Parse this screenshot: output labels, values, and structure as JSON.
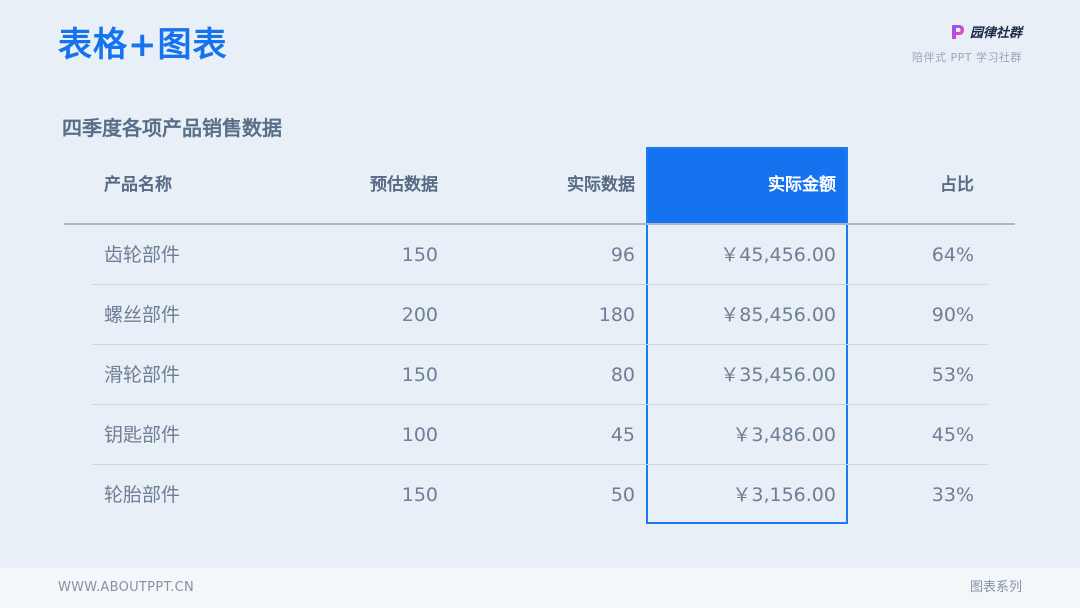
{
  "header": {
    "title": "表格+图表",
    "brand_name": "园律社群",
    "brand_tagline": "陪伴式 PPT 学习社群"
  },
  "subtitle": "四季度各项产品销售数据",
  "table": {
    "columns": [
      "产品名称",
      "预估数据",
      "实际数据",
      "实际金额",
      "占比"
    ],
    "highlight_column_index": 3,
    "rows": [
      [
        "齿轮部件",
        "150",
        "96",
        "￥45,456.00",
        "64%"
      ],
      [
        "螺丝部件",
        "200",
        "180",
        "￥85,456.00",
        "90%"
      ],
      [
        "滑轮部件",
        "150",
        "80",
        "￥35,456.00",
        "53%"
      ],
      [
        "钥匙部件",
        "100",
        "45",
        "￥3,486.00",
        "45%"
      ],
      [
        "轮胎部件",
        "150",
        "50",
        "￥3,156.00",
        "33%"
      ]
    ]
  },
  "footer": {
    "website": "WWW.ABOUTPPT.CN",
    "series": "图表系列"
  },
  "colors": {
    "accent": "#1673f0",
    "header_text": "#586a85",
    "cell_text": "#6e7f96",
    "background": "#e8eff6"
  },
  "icons": {
    "brand_logo": "p-logo-icon"
  }
}
